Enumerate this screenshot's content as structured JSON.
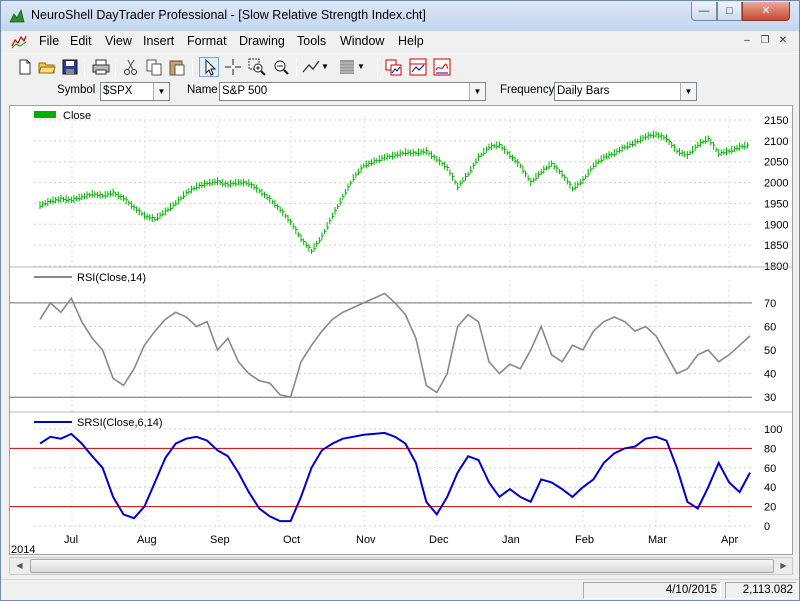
{
  "window": {
    "title": "NeuroShell DayTrader Professional - [Slow Relative Strength Index.cht]"
  },
  "menu": {
    "items": [
      "File",
      "Edit",
      "View",
      "Insert",
      "Format",
      "Drawing",
      "Tools",
      "Window",
      "Help"
    ]
  },
  "toolbar": {
    "icons": [
      "new-file-icon",
      "open-folder-icon",
      "save-icon",
      "print-icon",
      "cut-icon",
      "copy-icon",
      "paste-icon",
      "pointer-icon",
      "crosshair-icon",
      "zoom-in-icon",
      "zoom-out-icon",
      "line-tool-icon",
      "pattern-icon",
      "chart-page-icon",
      "indicator-icon",
      "predictor-icon"
    ]
  },
  "symbolbar": {
    "symbol_label": "Symbol",
    "symbol_value": "$SPX",
    "name_label": "Name",
    "name_value": "S&P 500",
    "frequency_label": "Frequency",
    "frequency_value": "Daily Bars"
  },
  "status": {
    "date": "4/10/2015",
    "value": "2,113.082"
  },
  "colors": {
    "price": "#00b000",
    "rsi": "#888888",
    "srsi": "#0000cc",
    "refline": "#cc0000"
  },
  "chart_data": [
    {
      "type": "line",
      "series": [
        {
          "name": "Close",
          "values": [
            1945,
            1955,
            1960,
            1958,
            1965,
            1972,
            1968,
            1975,
            1962,
            1940,
            1920,
            1912,
            1930,
            1950,
            1975,
            1990,
            1998,
            2002,
            1995,
            2000,
            1998,
            1980,
            1960,
            1935,
            1905,
            1865,
            1835,
            1870,
            1920,
            1965,
            2010,
            2040,
            2050,
            2060,
            2065,
            2072,
            2070,
            2075,
            2055,
            2035,
            1990,
            2020,
            2060,
            2085,
            2090,
            2065,
            2040,
            2000,
            2025,
            2045,
            2020,
            1985,
            2005,
            2040,
            2060,
            2070,
            2085,
            2095,
            2110,
            2115,
            2105,
            2075,
            2065,
            2090,
            2105,
            2070,
            2075,
            2085,
            2090
          ]
        }
      ],
      "x_labels": [
        "Jul",
        "Aug",
        "Sep",
        "Oct",
        "Nov",
        "Dec",
        "Jan",
        "Feb",
        "Mar",
        "Apr"
      ],
      "year_label": "2014",
      "y_ticks": [
        1800,
        1850,
        1900,
        1950,
        2000,
        2050,
        2100,
        2150
      ],
      "ylim": [
        1800,
        2150
      ]
    },
    {
      "type": "line",
      "series": [
        {
          "name": "RSI(Close,14)",
          "values": [
            63,
            70,
            66,
            72,
            62,
            55,
            50,
            38,
            35,
            42,
            52,
            58,
            63,
            66,
            64,
            60,
            62,
            50,
            55,
            45,
            40,
            37,
            36,
            31,
            30,
            45,
            52,
            58,
            63,
            66,
            68,
            70,
            72,
            74,
            70,
            65,
            55,
            35,
            32,
            40,
            60,
            65,
            62,
            45,
            40,
            44,
            42,
            50,
            60,
            48,
            45,
            52,
            50,
            58,
            62,
            64,
            62,
            58,
            60,
            56,
            48,
            40,
            42,
            48,
            50,
            45,
            48,
            52,
            56
          ]
        }
      ],
      "y_ticks": [
        30,
        40,
        50,
        60,
        70
      ],
      "ref_lines": [
        30,
        70
      ],
      "ylim": [
        25,
        78
      ]
    },
    {
      "type": "line",
      "series": [
        {
          "name": "SRSI(Close,6,14)",
          "values": [
            85,
            92,
            90,
            95,
            85,
            72,
            60,
            30,
            12,
            8,
            20,
            45,
            70,
            85,
            90,
            92,
            88,
            78,
            72,
            55,
            35,
            18,
            10,
            5,
            5,
            30,
            60,
            78,
            85,
            90,
            92,
            94,
            95,
            96,
            92,
            85,
            65,
            25,
            12,
            30,
            55,
            72,
            68,
            45,
            30,
            38,
            30,
            25,
            48,
            45,
            38,
            30,
            40,
            48,
            65,
            75,
            80,
            82,
            90,
            92,
            88,
            60,
            25,
            18,
            40,
            65,
            45,
            35,
            55
          ]
        }
      ],
      "y_ticks": [
        0,
        20,
        40,
        60,
        80,
        100
      ],
      "ref_lines": [
        20,
        80
      ],
      "ylim": [
        0,
        100
      ]
    }
  ]
}
